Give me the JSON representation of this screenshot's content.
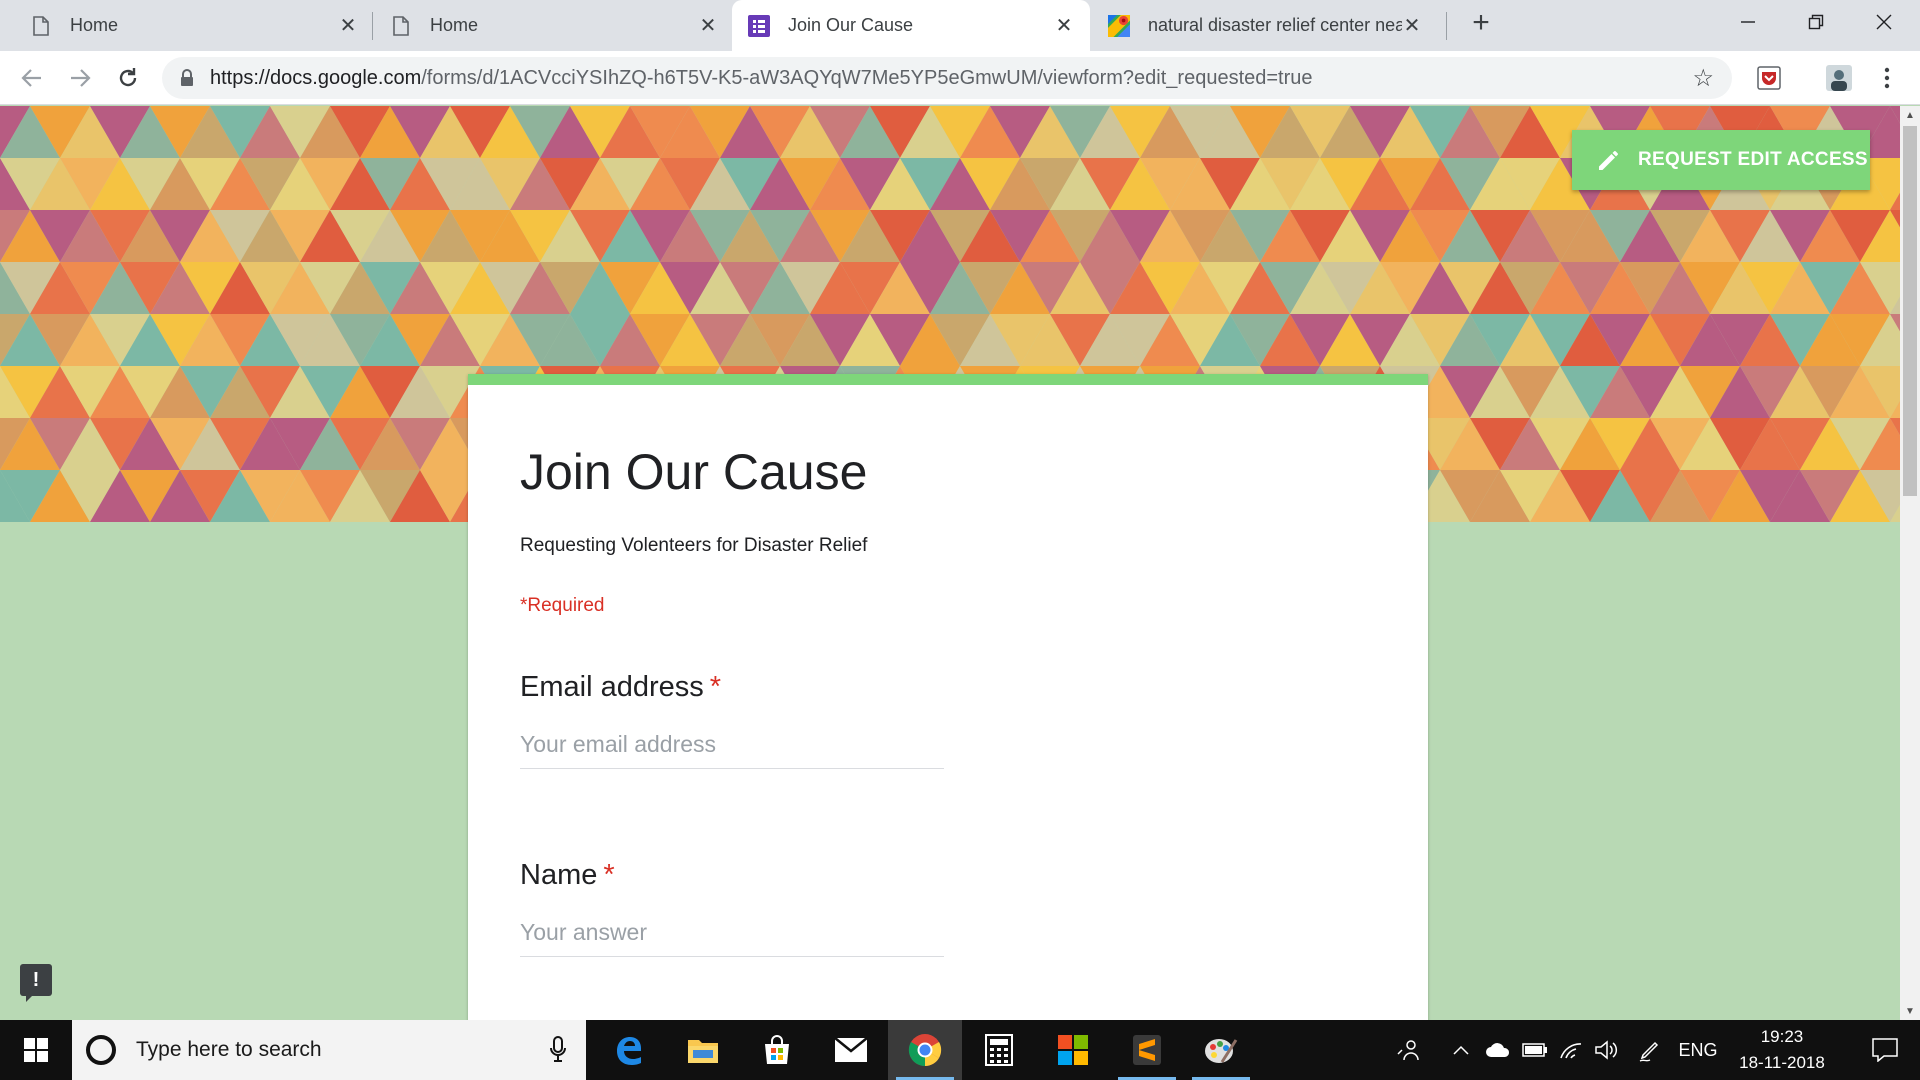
{
  "browser": {
    "tabs": [
      {
        "label": "Home",
        "icon": "document-icon",
        "active": false
      },
      {
        "label": "Home",
        "icon": "document-icon",
        "active": false
      },
      {
        "label": "Join Our Cause",
        "icon": "google-forms-icon",
        "active": true
      },
      {
        "label": "natural disaster relief center near",
        "icon": "google-maps-icon",
        "active": false
      }
    ],
    "url_host": "https://docs.google.com",
    "url_path": "/forms/d/1ACVcciYSIhZQ-h6T5V-K5-aW3AQYqW7Me5YP5eGmwUM/viewform?edit_requested=true"
  },
  "page": {
    "edit_button_label": "REQUEST EDIT ACCESS",
    "form": {
      "title": "Join Our Cause",
      "description": "Requesting Volenteers for Disaster Relief",
      "required_note": "*Required",
      "questions": [
        {
          "label": "Email address",
          "required_mark": "*",
          "placeholder": "Your email address"
        },
        {
          "label": "Name",
          "required_mark": "*",
          "placeholder": "Your answer"
        }
      ]
    },
    "feedback_label": "!"
  },
  "taskbar": {
    "search_placeholder": "Type here to search",
    "language": "ENG",
    "time": "19:23",
    "date": "18-11-2018"
  },
  "colors": {
    "accent_green": "#7ed67a",
    "page_background": "#b8d9b4",
    "required_red": "#d93025"
  }
}
